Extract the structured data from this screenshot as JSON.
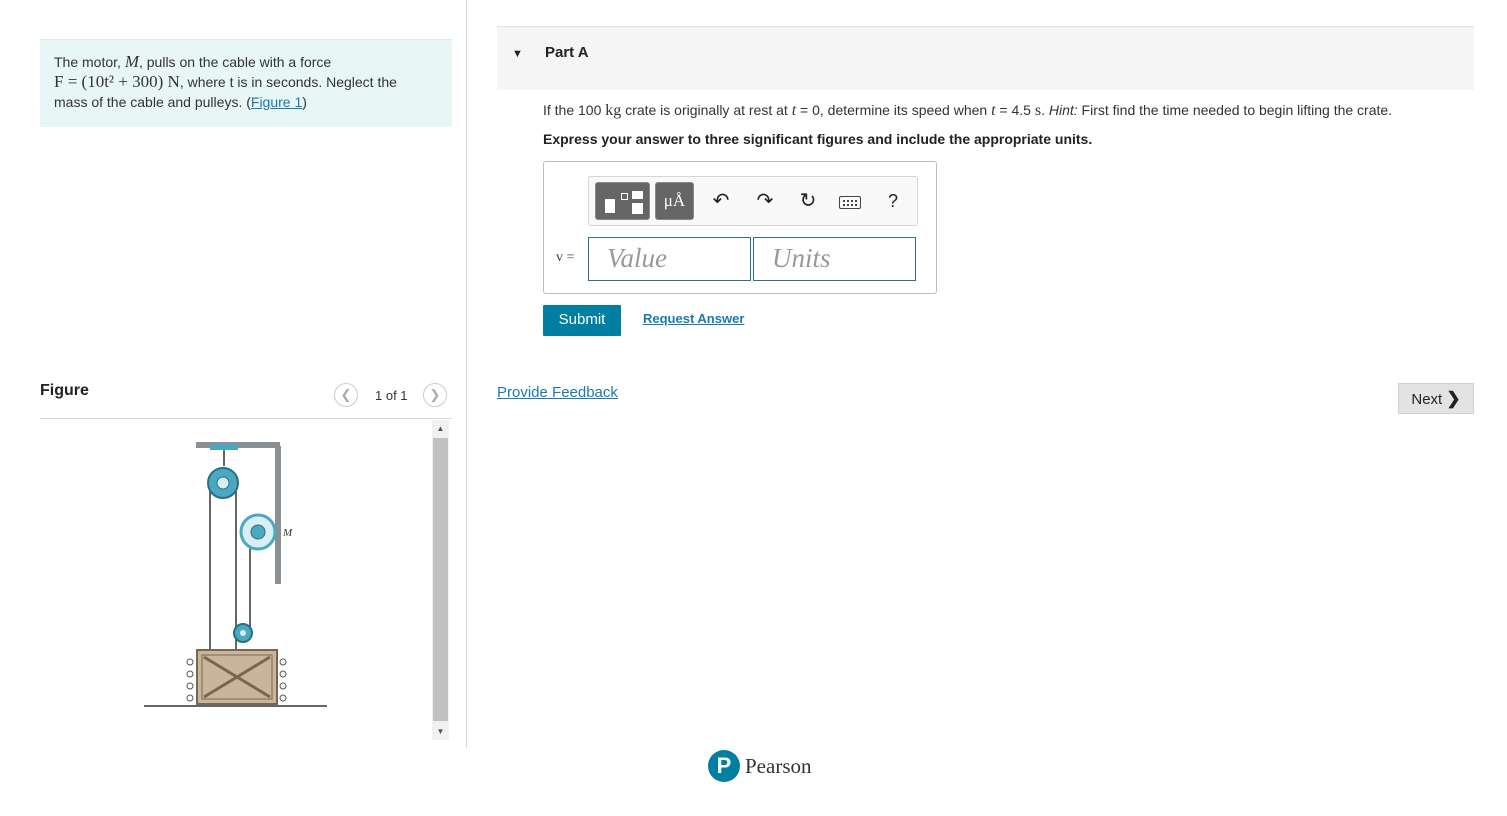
{
  "problem": {
    "text1": "The motor, ",
    "motor_symbol": "M",
    "text2": ", pulls on the cable with a force",
    "force_expr": "F = (10t² + 300) N",
    "text3": ", where t is in seconds. Neglect the",
    "text4": "mass of the cable and pulleys. (",
    "figure_link": "Figure 1",
    "text5": ")"
  },
  "figure": {
    "title": "Figure",
    "count": "1 of 1",
    "prev_icon": "chevron-left",
    "next_icon": "chevron-right",
    "motor_label": "M"
  },
  "part": {
    "title": "Part A",
    "caret_icon": "caret-down"
  },
  "question": {
    "q1": "If the 100 ",
    "mass_unit": "kg",
    "q2": " crate is originally at rest at ",
    "t1": "t",
    "q3": " = 0, determine its speed when ",
    "t2": "t",
    "q4": " = 4.5 ",
    "time_unit": "s",
    "q5": ". ",
    "hint_label": "Hint:",
    "q6": " First find the time needed to begin lifting the crate.",
    "instruction": "Express your answer to three significant figures and include the appropriate units."
  },
  "answer": {
    "units_button": "μÅ",
    "help": "?",
    "variable": "v =",
    "value_placeholder": "Value",
    "units_placeholder": "Units",
    "toolbar_icons": [
      "templates-icon",
      "units-icon",
      "undo-icon",
      "redo-icon",
      "reset-icon",
      "keyboard-icon",
      "help-icon"
    ]
  },
  "actions": {
    "submit": "Submit",
    "request_answer": "Request Answer",
    "provide_feedback": "Provide Feedback",
    "next": "Next",
    "next_icon": "chevron-right"
  },
  "footer": {
    "logo_letter": "P",
    "brand": "Pearson",
    "brand_color": "#007fa3"
  },
  "colors": {
    "accent": "#007fa3",
    "link": "#1a7ab0",
    "problem_bg": "#e9f6f6"
  }
}
